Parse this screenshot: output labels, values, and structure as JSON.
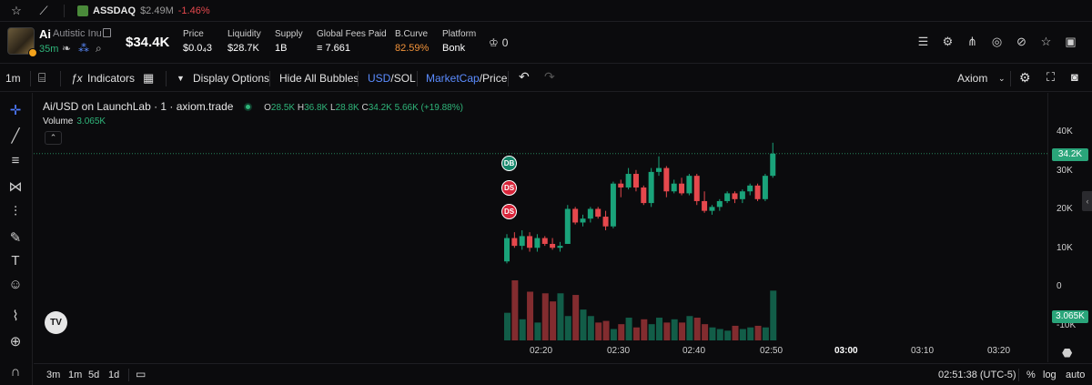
{
  "ticker": {
    "symbol": "ASSDAQ",
    "cap": "$2.49M",
    "change": "-1.46%"
  },
  "token": {
    "symbol": "Ai",
    "name": "Autistic Inu",
    "age": "35m",
    "market_cap": "$34.4K",
    "stats": [
      {
        "label": "Price",
        "value": "$0.0₄3"
      },
      {
        "label": "Liquidity",
        "value": "$28.7K"
      },
      {
        "label": "Supply",
        "value": "1B"
      },
      {
        "label": "Global Fees Paid",
        "value": "≡ 7.661"
      },
      {
        "label": "B.Curve",
        "value": "82.59%"
      },
      {
        "label": "Platform",
        "value": "Bonk"
      }
    ],
    "holders_count": "0"
  },
  "toolbar": {
    "interval": "1m",
    "indicators": "Indicators",
    "display_options": "Display Options",
    "hide_bubbles": "Hide All Bubbles",
    "currency_usd": "USD",
    "currency_sol": "SOL",
    "metric_mcap": "MarketCap",
    "metric_price": "Price",
    "source": "Axiom"
  },
  "legend": {
    "title": "Ai/USD on LaunchLab · 1 · axiom.trade",
    "o": "28.5K",
    "h": "36.8K",
    "l": "28.8K",
    "c": "34.2K",
    "change": "5.66K (+19.88%)",
    "volume_label": "Volume",
    "volume_value": "3.065K"
  },
  "bubbles": [
    "DB",
    "DS",
    "DS"
  ],
  "price_axis": {
    "ticks": [
      "40K",
      "30K",
      "20K",
      "10K",
      "0",
      "-10K"
    ],
    "current_price": "34.2K",
    "current_volume": "3.065K"
  },
  "time_axis": [
    "02:20",
    "02:30",
    "02:40",
    "02:50",
    "03:00",
    "03:10",
    "03:20"
  ],
  "bottom": {
    "ranges": [
      "3m",
      "1m",
      "5d",
      "1d"
    ],
    "clock": "02:51:38 (UTC-5)",
    "pct": "%",
    "log": "log",
    "auto": "auto"
  },
  "chart_data": {
    "type": "candlestick",
    "ylim": [
      -10000,
      45000
    ],
    "candles": [
      {
        "t": "02:16",
        "o": 6500,
        "h": 13500,
        "l": 6000,
        "c": 12500
      },
      {
        "t": "02:17",
        "o": 12500,
        "h": 14000,
        "l": 10000,
        "c": 10500
      },
      {
        "t": "02:18",
        "o": 10500,
        "h": 14500,
        "l": 9500,
        "c": 13000
      },
      {
        "t": "02:19",
        "o": 13000,
        "h": 14000,
        "l": 9000,
        "c": 10000
      },
      {
        "t": "02:20",
        "o": 10000,
        "h": 13500,
        "l": 9000,
        "c": 12500
      },
      {
        "t": "02:21",
        "o": 12500,
        "h": 13000,
        "l": 10500,
        "c": 11000
      },
      {
        "t": "02:22",
        "o": 11000,
        "h": 12500,
        "l": 9500,
        "c": 10000
      },
      {
        "t": "02:23",
        "o": 10000,
        "h": 11500,
        "l": 9000,
        "c": 10500
      },
      {
        "t": "02:24",
        "o": 11000,
        "h": 21000,
        "l": 11000,
        "c": 20000
      },
      {
        "t": "02:25",
        "o": 20000,
        "h": 20500,
        "l": 16000,
        "c": 16500
      },
      {
        "t": "02:26",
        "o": 16500,
        "h": 18500,
        "l": 15500,
        "c": 17500
      },
      {
        "t": "02:27",
        "o": 17500,
        "h": 20500,
        "l": 16500,
        "c": 20000
      },
      {
        "t": "02:28",
        "o": 20000,
        "h": 20500,
        "l": 17500,
        "c": 18000
      },
      {
        "t": "02:29",
        "o": 18000,
        "h": 19500,
        "l": 14500,
        "c": 15500
      },
      {
        "t": "02:30",
        "o": 15500,
        "h": 27000,
        "l": 15000,
        "c": 26500
      },
      {
        "t": "02:31",
        "o": 26500,
        "h": 27500,
        "l": 23000,
        "c": 25500
      },
      {
        "t": "02:32",
        "o": 25500,
        "h": 30500,
        "l": 25000,
        "c": 29000
      },
      {
        "t": "02:33",
        "o": 29000,
        "h": 30000,
        "l": 24500,
        "c": 25500
      },
      {
        "t": "02:34",
        "o": 25500,
        "h": 26000,
        "l": 21000,
        "c": 21500
      },
      {
        "t": "02:35",
        "o": 21500,
        "h": 30500,
        "l": 20500,
        "c": 29500
      },
      {
        "t": "02:36",
        "o": 29500,
        "h": 33500,
        "l": 28500,
        "c": 30500
      },
      {
        "t": "02:37",
        "o": 30500,
        "h": 31000,
        "l": 23000,
        "c": 24500
      },
      {
        "t": "02:38",
        "o": 24500,
        "h": 27500,
        "l": 24000,
        "c": 26500
      },
      {
        "t": "02:39",
        "o": 26500,
        "h": 28000,
        "l": 23500,
        "c": 24000
      },
      {
        "t": "02:40",
        "o": 24000,
        "h": 29000,
        "l": 23500,
        "c": 28500
      },
      {
        "t": "02:41",
        "o": 28500,
        "h": 29000,
        "l": 21000,
        "c": 22000
      },
      {
        "t": "02:42",
        "o": 22000,
        "h": 24500,
        "l": 19000,
        "c": 19500
      },
      {
        "t": "02:43",
        "o": 19500,
        "h": 21000,
        "l": 18500,
        "c": 20500
      },
      {
        "t": "02:44",
        "o": 20500,
        "h": 22500,
        "l": 19500,
        "c": 22000
      },
      {
        "t": "02:45",
        "o": 22000,
        "h": 24500,
        "l": 21500,
        "c": 24000
      },
      {
        "t": "02:46",
        "o": 24000,
        "h": 24500,
        "l": 21500,
        "c": 22500
      },
      {
        "t": "02:47",
        "o": 22500,
        "h": 25000,
        "l": 21500,
        "c": 24500
      },
      {
        "t": "02:48",
        "o": 24500,
        "h": 26500,
        "l": 23500,
        "c": 26000
      },
      {
        "t": "02:49",
        "o": 26000,
        "h": 26500,
        "l": 22000,
        "c": 22500
      },
      {
        "t": "02:50",
        "o": 22500,
        "h": 29000,
        "l": 22000,
        "c": 28500
      },
      {
        "t": "02:51",
        "o": 28500,
        "h": 37000,
        "l": 28000,
        "c": 34200
      }
    ],
    "volumes": [
      1700,
      3700,
      1300,
      3000,
      1100,
      2900,
      2400,
      2900,
      1500,
      2800,
      1900,
      1500,
      1100,
      1200,
      700,
      1000,
      1400,
      800,
      1300,
      1000,
      1400,
      1100,
      1300,
      1100,
      1500,
      1400,
      1000,
      800,
      700,
      600,
      900,
      700,
      800,
      900,
      800,
      3065
    ]
  }
}
